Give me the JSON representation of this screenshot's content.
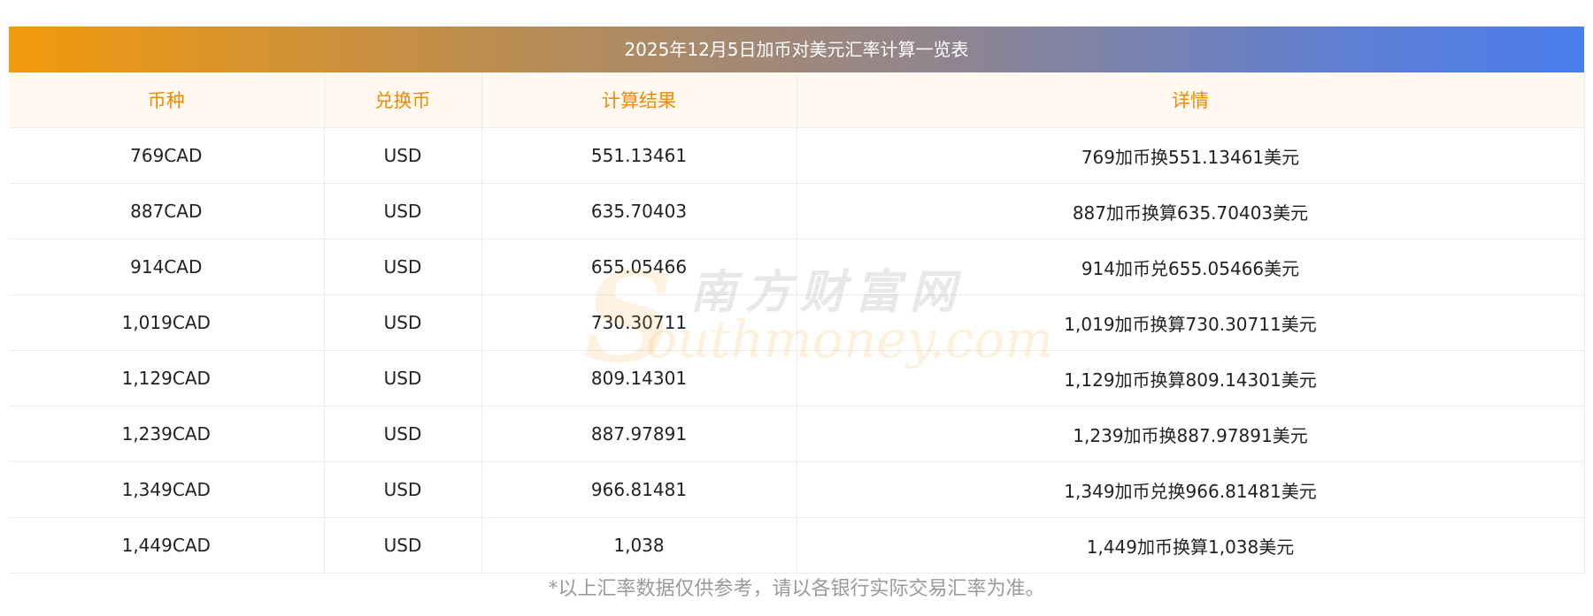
{
  "title": "2025年12月5日加币对美元汇率计算一览表",
  "headers": [
    "币种",
    "兑换币",
    "计算结果",
    "详情"
  ],
  "rows": [
    {
      "currency": "769CAD",
      "target": "USD",
      "result": "551.13461",
      "detail": "769加币换551.13461美元"
    },
    {
      "currency": "887CAD",
      "target": "USD",
      "result": "635.70403",
      "detail": "887加币换算635.70403美元"
    },
    {
      "currency": "914CAD",
      "target": "USD",
      "result": "655.05466",
      "detail": "914加币兑655.05466美元"
    },
    {
      "currency": "1,019CAD",
      "target": "USD",
      "result": "730.30711",
      "detail": "1,019加币换算730.30711美元"
    },
    {
      "currency": "1,129CAD",
      "target": "USD",
      "result": "809.14301",
      "detail": "1,129加币换算809.14301美元"
    },
    {
      "currency": "1,239CAD",
      "target": "USD",
      "result": "887.97891",
      "detail": "1,239加币换887.97891美元"
    },
    {
      "currency": "1,349CAD",
      "target": "USD",
      "result": "966.81481",
      "detail": "1,349加币兑换966.81481美元"
    },
    {
      "currency": "1,449CAD",
      "target": "USD",
      "result": "1,038",
      "detail": "1,449加币换算1,038美元"
    }
  ],
  "footnote": "*以上汇率数据仅供参考，请以各银行实际交易汇率为准。",
  "watermark": {
    "cn": "南方财富网",
    "en": "outhmoney.com",
    "s": "S"
  },
  "colors": {
    "header_text": "#f08a00",
    "title_gradient_start": "#f39a0c",
    "title_gradient_end": "#4a7ded",
    "footnote_text": "#9a9a9a"
  }
}
